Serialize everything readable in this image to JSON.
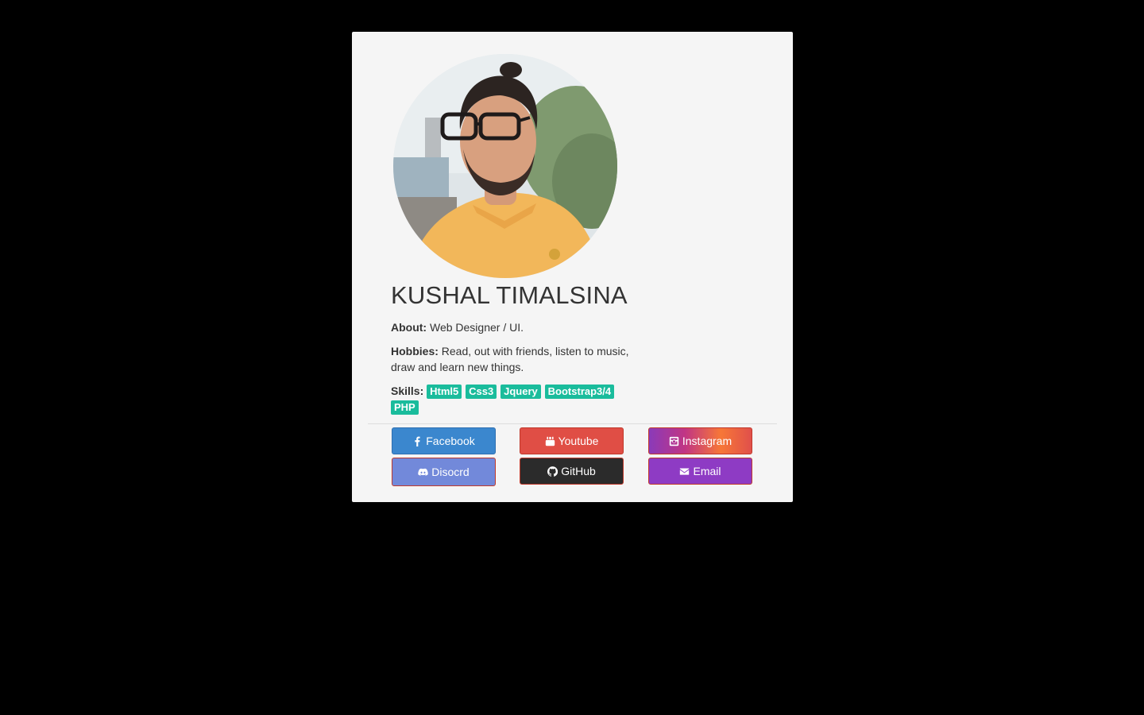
{
  "profile": {
    "name": "KUSHAL TIMALSINA",
    "about_label": "About:",
    "about_text": "Web Designer / UI.",
    "hobbies_label": "Hobbies:",
    "hobbies_text": "Read, out with friends, listen to music, draw and learn new things.",
    "skills_label": "Skills:",
    "skills": [
      "Html5",
      "Css3",
      "Jquery",
      "Bootstrap3/4",
      "PHP"
    ]
  },
  "social": {
    "facebook": {
      "label": "Facebook",
      "icon": "facebook-icon",
      "color": "#3b87ce"
    },
    "youtube": {
      "label": "Youtube",
      "icon": "youtube-icon",
      "color": "#e04e45"
    },
    "instagram": {
      "label": "Instagram",
      "icon": "instagram-icon",
      "color": "#c13584"
    },
    "discord": {
      "label": "Disocrd",
      "icon": "discord-icon",
      "color": "#7289da"
    },
    "github": {
      "label": "GitHub",
      "icon": "github-icon",
      "color": "#2b2b2b"
    },
    "email": {
      "label": "Email",
      "icon": "envelope-icon",
      "color": "#8e3bc4"
    }
  },
  "colors": {
    "background": "#000000",
    "card": "#f5f5f5",
    "skill_badge": "#1abc9c"
  }
}
